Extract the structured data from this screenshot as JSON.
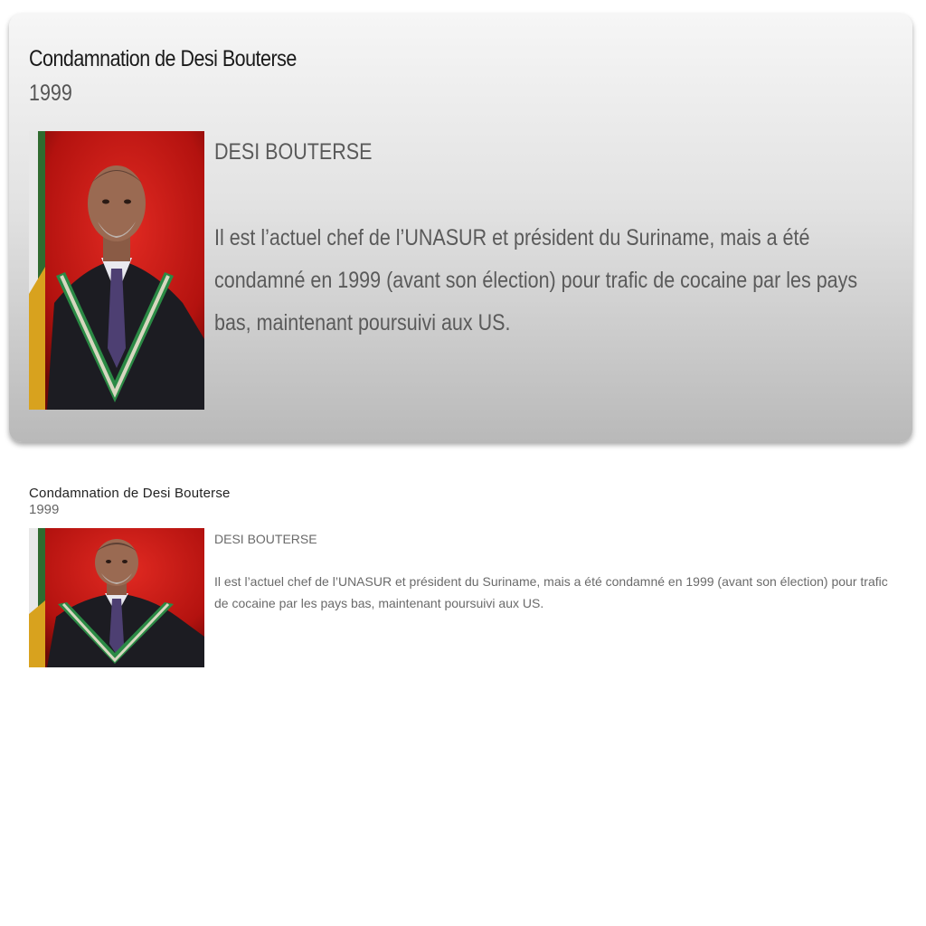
{
  "cards": [
    {
      "title": "Condamnation de Desi Bouterse",
      "year": "1999",
      "name": "DESI BOUTERSE",
      "description": "Il est l’actuel chef de l’UNASUR et président du Suriname, mais a été condamné en 1999 (avant son élection) pour trafic de cocaine par les pays bas, maintenant poursuivi aux US.",
      "photo_icon": "portrait-photo"
    }
  ]
}
